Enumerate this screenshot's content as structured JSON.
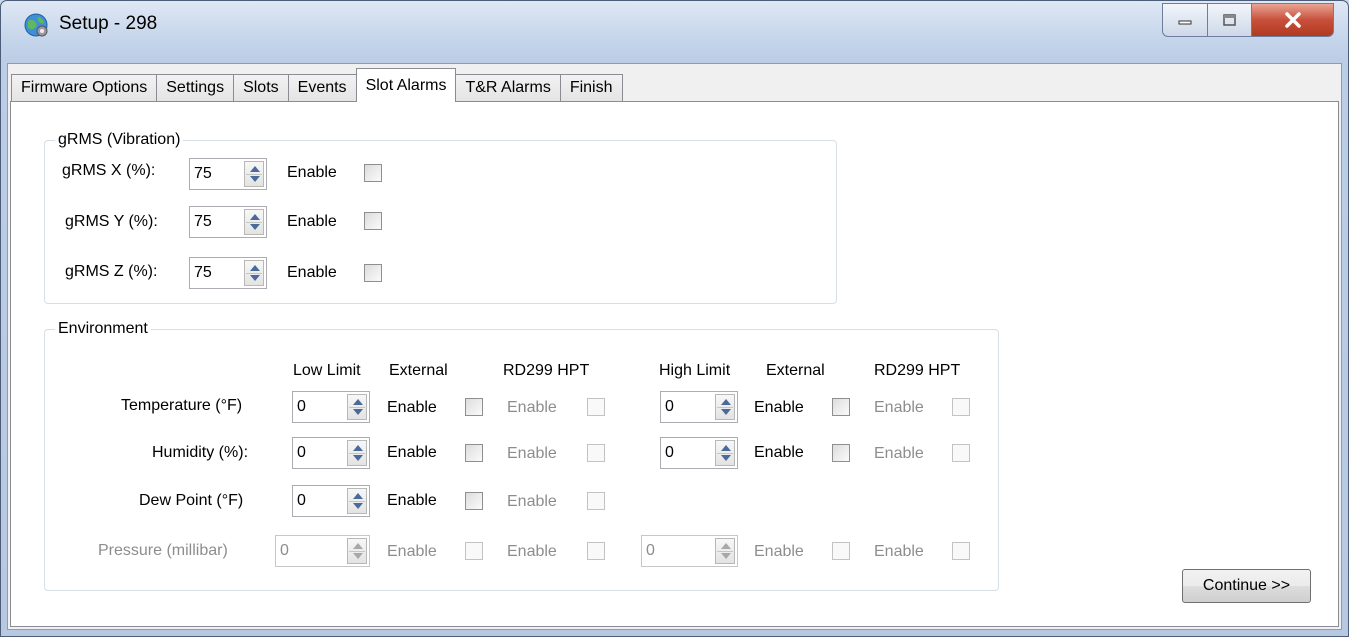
{
  "window": {
    "title": "Setup - 298",
    "accent_close": "#c7503a"
  },
  "tabs": [
    {
      "label": "Firmware Options"
    },
    {
      "label": "Settings"
    },
    {
      "label": "Slots"
    },
    {
      "label": "Events"
    },
    {
      "label": "Slot Alarms",
      "selected": true
    },
    {
      "label": "T&R Alarms"
    },
    {
      "label": "Finish"
    }
  ],
  "grms": {
    "legend": "gRMS (Vibration)",
    "enable_label": "Enable",
    "rows": [
      {
        "label": "gRMS X (%):",
        "value": "75",
        "enabled": false
      },
      {
        "label": "gRMS Y (%):",
        "value": "75",
        "enabled": false
      },
      {
        "label": "gRMS Z (%):",
        "value": "75",
        "enabled": false
      }
    ]
  },
  "environment": {
    "legend": "Environment",
    "headers": {
      "low_limit": "Low Limit",
      "external_low": "External",
      "rd299_low": "RD299 HPT",
      "high_limit": "High Limit",
      "external_high": "External",
      "rd299_high": "RD299 HPT"
    },
    "enable_label": "Enable",
    "rows": [
      {
        "label": "Temperature (°F)",
        "low": "0",
        "high": "0"
      },
      {
        "label": "Humidity (%):",
        "low": "0",
        "high": "0"
      },
      {
        "label": "Dew Point (°F)",
        "low": "0"
      },
      {
        "label": "Pressure (millibar)",
        "low": "0",
        "high": "0",
        "disabled": true
      }
    ]
  },
  "continue_button": "Continue >>"
}
